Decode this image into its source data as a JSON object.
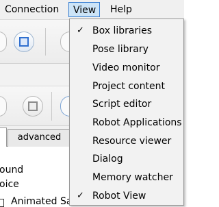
{
  "menubar": {
    "items": [
      {
        "label": "Connection"
      },
      {
        "label": "View"
      },
      {
        "label": "Help"
      }
    ]
  },
  "tabs": {
    "advanced_label": "advanced"
  },
  "content": {
    "line1": "ound",
    "line2": "oice",
    "line3": "Animated Sa"
  },
  "view_menu": {
    "items": [
      {
        "label": "Box libraries",
        "checked": true,
        "check": "✓"
      },
      {
        "label": "Pose library",
        "checked": false,
        "check": ""
      },
      {
        "label": "Video monitor",
        "checked": false,
        "check": ""
      },
      {
        "label": "Project content",
        "checked": false,
        "check": ""
      },
      {
        "label": "Script editor",
        "checked": false,
        "check": ""
      },
      {
        "label": "Robot Applications",
        "checked": false,
        "check": ""
      },
      {
        "label": "Resource viewer",
        "checked": false,
        "check": ""
      },
      {
        "label": "Dialog",
        "checked": false,
        "check": ""
      },
      {
        "label": "Memory watcher",
        "checked": false,
        "check": ""
      },
      {
        "label": "Robot View",
        "checked": true,
        "check": "✓"
      }
    ]
  },
  "colors": {
    "menu_highlight": "#cce4f7",
    "menu_highlight_border": "#3a7fd1",
    "toolbar_accent": "#2f6fcf"
  }
}
